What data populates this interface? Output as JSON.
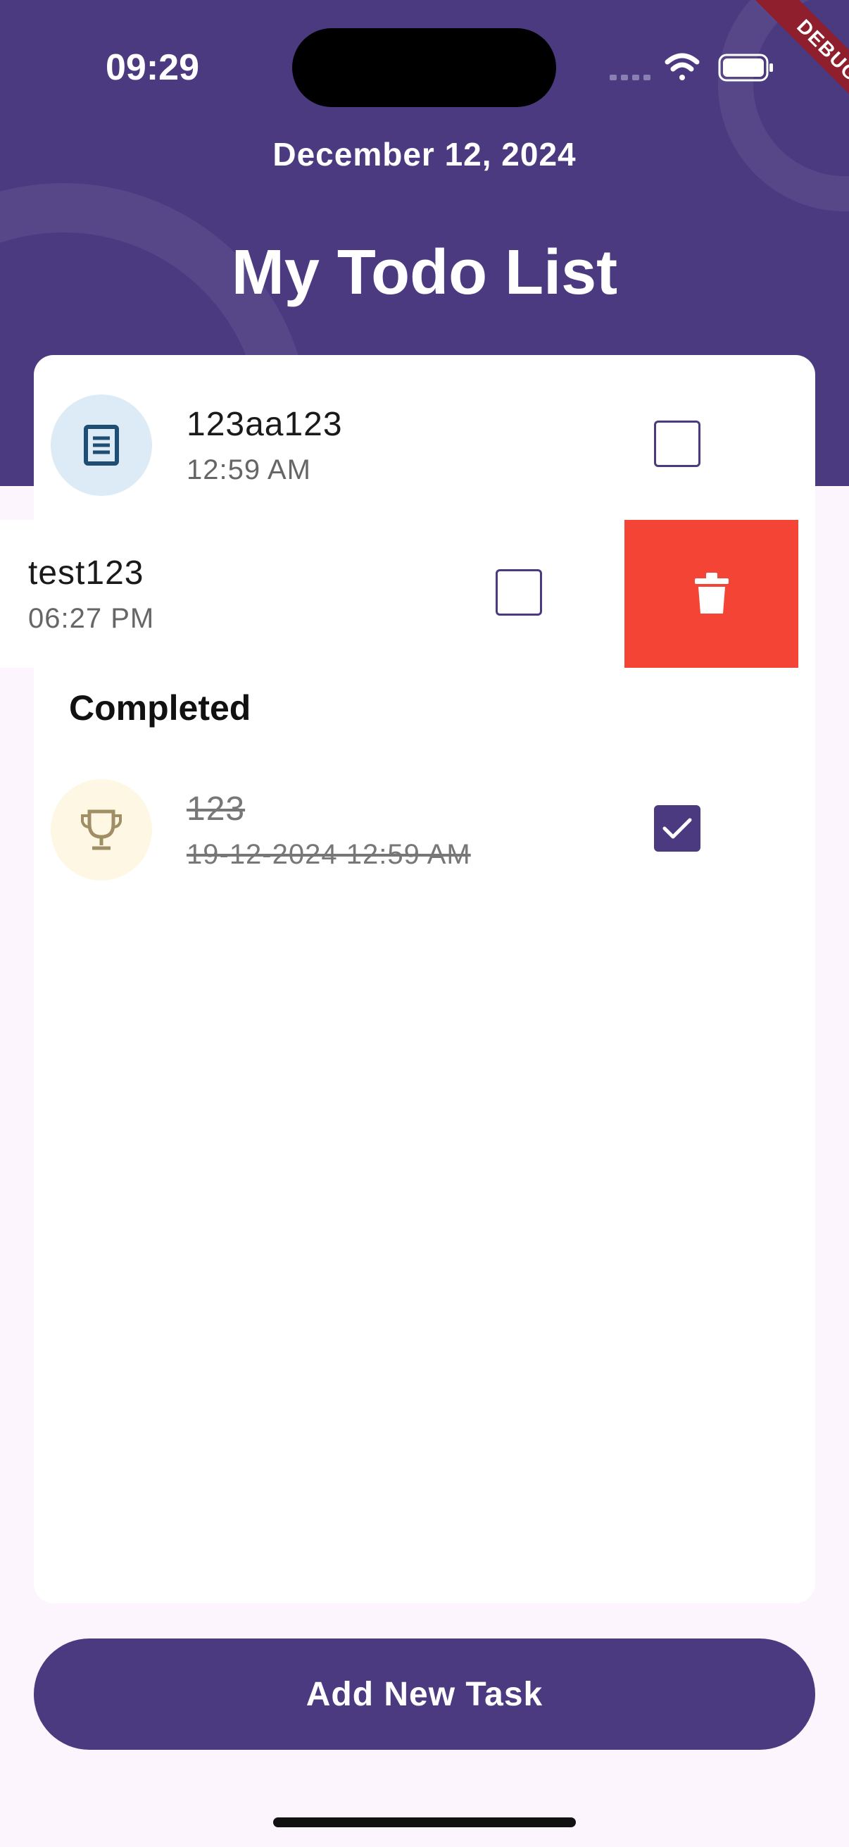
{
  "status_bar": {
    "time": "09:29",
    "icons": [
      "cellular-dots-icon",
      "wifi-icon",
      "battery-icon"
    ],
    "debug_label": "DEBUG"
  },
  "header": {
    "date": "December 12, 2024",
    "title": "My Todo List"
  },
  "tasks": [
    {
      "title": "123aa123",
      "time": "12:59 AM",
      "icon": "document-icon",
      "checked": false
    },
    {
      "title": "test123",
      "time": "06:27 PM",
      "icon": "document-icon",
      "checked": false,
      "swiped": true
    }
  ],
  "completed": {
    "label": "Completed",
    "items": [
      {
        "title": "123",
        "time": "19-12-2024 12:59 AM",
        "icon": "trophy-icon",
        "checked": true
      }
    ]
  },
  "actions": {
    "delete_icon": "trash-icon",
    "add_button": "Add New Task"
  },
  "colors": {
    "primary": "#4b3a80",
    "delete": "#f34436",
    "background": "#fcf5fd",
    "icon_blue_bg": "#dcebf6",
    "icon_yellow_bg": "#fdf7e4"
  }
}
